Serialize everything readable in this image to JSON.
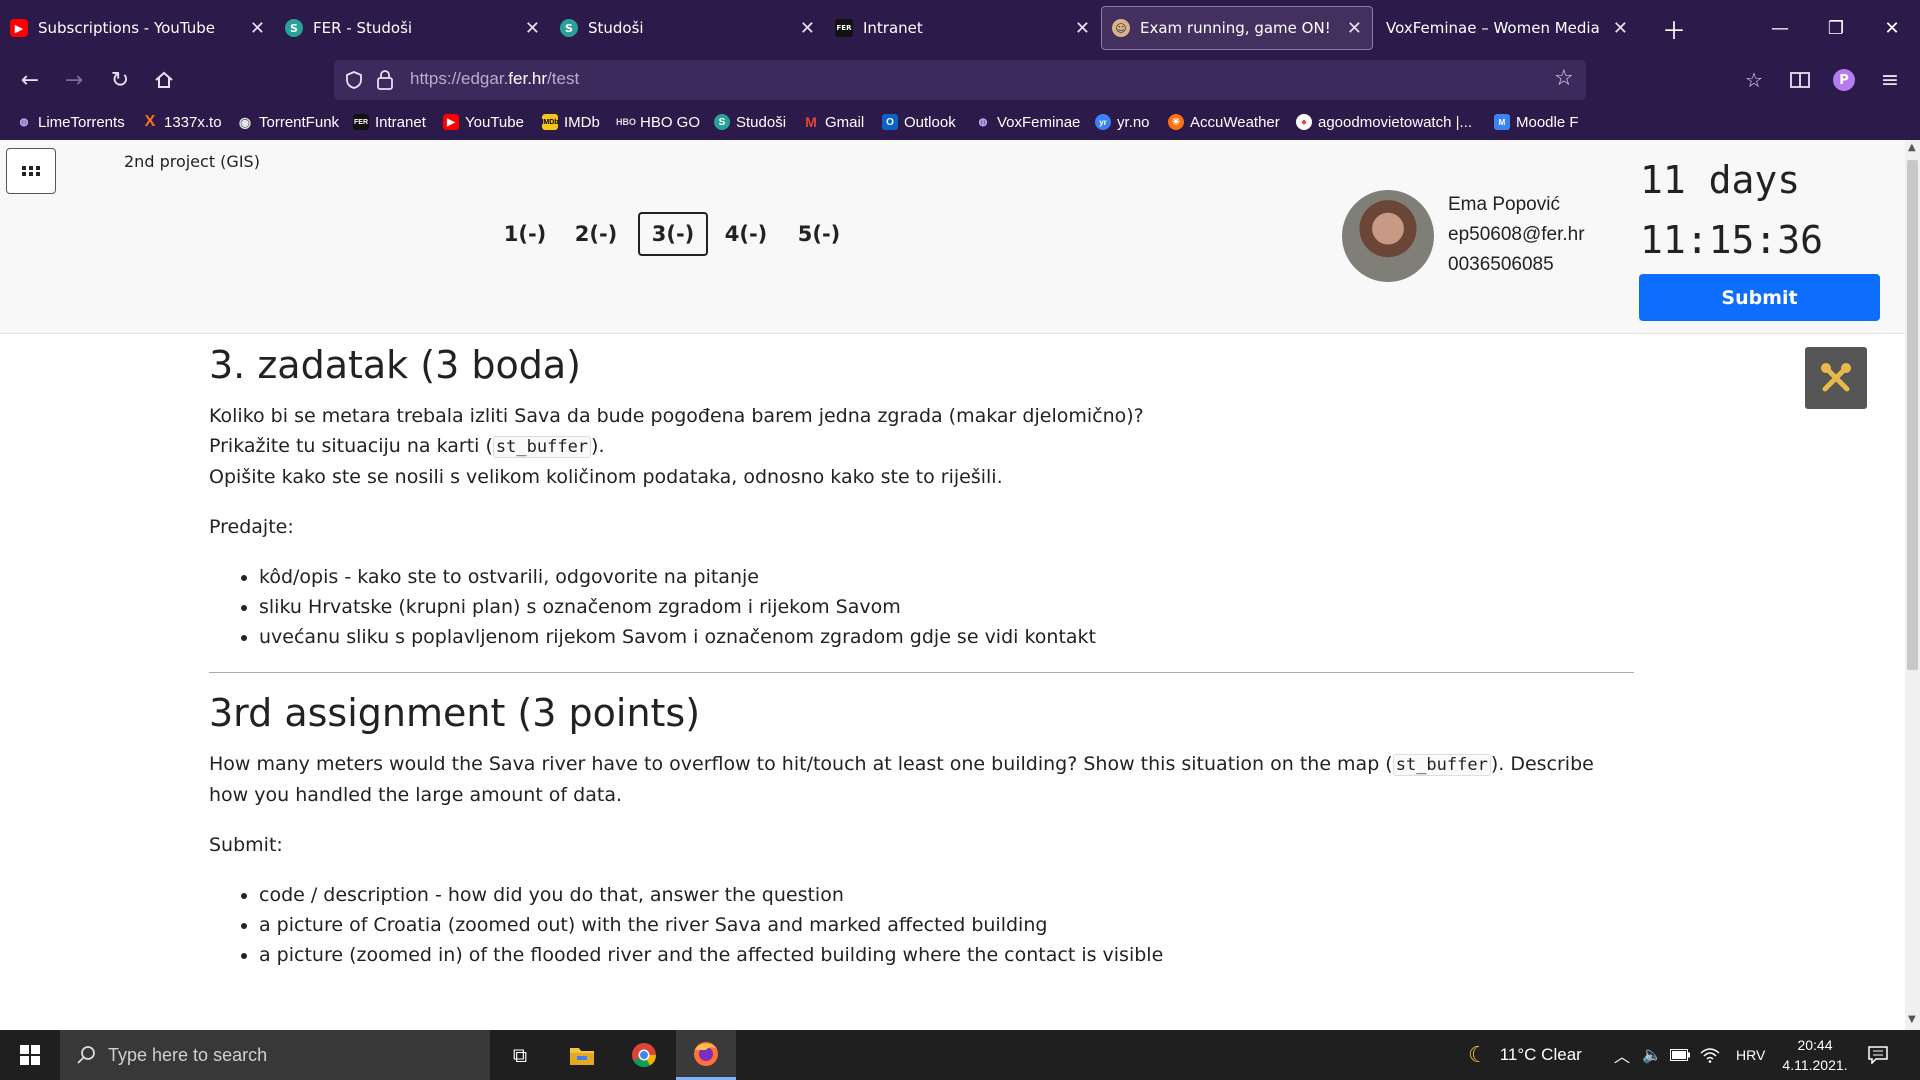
{
  "browser": {
    "tabs": [
      {
        "title": "Subscriptions - YouTube",
        "fav_bg": "#ff0000",
        "fav_glyph": "▶"
      },
      {
        "title": "FER - Studoši",
        "fav_bg": "#2aa198",
        "fav_glyph": "S"
      },
      {
        "title": "Studoši",
        "fav_bg": "#2aa198",
        "fav_glyph": "S"
      },
      {
        "title": "Intranet",
        "fav_bg": "#222222",
        "fav_glyph": "FER"
      },
      {
        "title": "Exam running, game ON!",
        "fav_bg": "#d9b38c",
        "fav_glyph": "☺"
      },
      {
        "title": "VoxFeminae – Women Media Inde",
        "fav_bg": "",
        "fav_glyph": ""
      }
    ],
    "url_prefix": "https://edgar.",
    "url_domain": "fer.hr",
    "url_suffix": "/test",
    "profile_initial": "P",
    "bookmarks": [
      {
        "label": "LimeTorrents",
        "color": "#a78bfa",
        "glyph": "◍"
      },
      {
        "label": "1337x.to",
        "color": "#f97316",
        "glyph": "X"
      },
      {
        "label": "TorrentFunk",
        "color": "#d4d4d4",
        "glyph": "◉"
      },
      {
        "label": "Intranet",
        "color": "#222222",
        "glyph": "F"
      },
      {
        "label": "YouTube",
        "color": "#ff0000",
        "glyph": "▶"
      },
      {
        "label": "IMDb",
        "color": "#f5c518",
        "glyph": "i"
      },
      {
        "label": "HBO GO",
        "color": "#cfcfcf",
        "glyph": "H"
      },
      {
        "label": "Studoši",
        "color": "#2aa198",
        "glyph": "S"
      },
      {
        "label": "Gmail",
        "color": "#ea4335",
        "glyph": "M"
      },
      {
        "label": "Outlook",
        "color": "#0a64c8",
        "glyph": "O"
      },
      {
        "label": "VoxFeminae",
        "color": "#a78bfa",
        "glyph": "◍"
      },
      {
        "label": "yr.no",
        "color": "#3b82f6",
        "glyph": "yr"
      },
      {
        "label": "AccuWeather",
        "color": "#f97316",
        "glyph": "☀"
      },
      {
        "label": "agoodmovietowatch |...",
        "color": "#ef4444",
        "glyph": "●"
      },
      {
        "label": "Moodle F",
        "color": "#3b82f6",
        "glyph": "M"
      }
    ]
  },
  "page": {
    "project_title": "2nd project (GIS)",
    "questions": [
      "1(-)",
      "2(-)",
      "3(-)",
      "4(-)",
      "5(-)"
    ],
    "selected_question": "3(-)",
    "user": {
      "name": "Ema Popović",
      "email": "ep50608@fer.hr",
      "jmbag": "0036506085"
    },
    "timer": {
      "days": "11 days",
      "time": "11:15:36"
    },
    "submit_label": "Submit"
  },
  "task_hr": {
    "heading": "3. zadatak (3 boda)",
    "line1": "Koliko bi se metara trebala izliti Sava da bude pogođena barem jedna zgrada (makar djelomično)?",
    "line2_pre": "Prikažite tu situaciju na karti (",
    "line2_code": "st_buffer",
    "line2_post": ").",
    "line3": "Opišite kako ste se nosili s velikom količinom podataka, odnosno kako ste to riješili.",
    "submit_label": "Predajte:",
    "items": [
      "kôd/opis - kako ste to ostvarili, odgovorite na pitanje",
      "sliku Hrvatske (krupni plan) s označenom zgradom i rijekom Savom",
      "uvećanu sliku s poplavljenom rijekom Savom i označenom zgradom gdje se vidi kontakt"
    ]
  },
  "task_en": {
    "heading": "3rd assignment (3 points)",
    "text_pre": "How many meters would the Sava river have to overflow to hit/touch at least one building? Show this situation on the map (",
    "text_code": "st_buffer",
    "text_post": "). Describe how you handled the large amount of data.",
    "submit_label": "Submit:",
    "items": [
      "code / description - how did you do that, answer the question",
      "a picture of Croatia (zoomed out) with the river Sava and marked affected building",
      "a picture (zoomed in) of the flooded river and the affected building where the contact is visible"
    ]
  },
  "taskbar": {
    "search_placeholder": "Type here to search",
    "weather": "11°C  Clear",
    "language": "HRV",
    "time": "20:44",
    "date": "4.11.2021."
  }
}
